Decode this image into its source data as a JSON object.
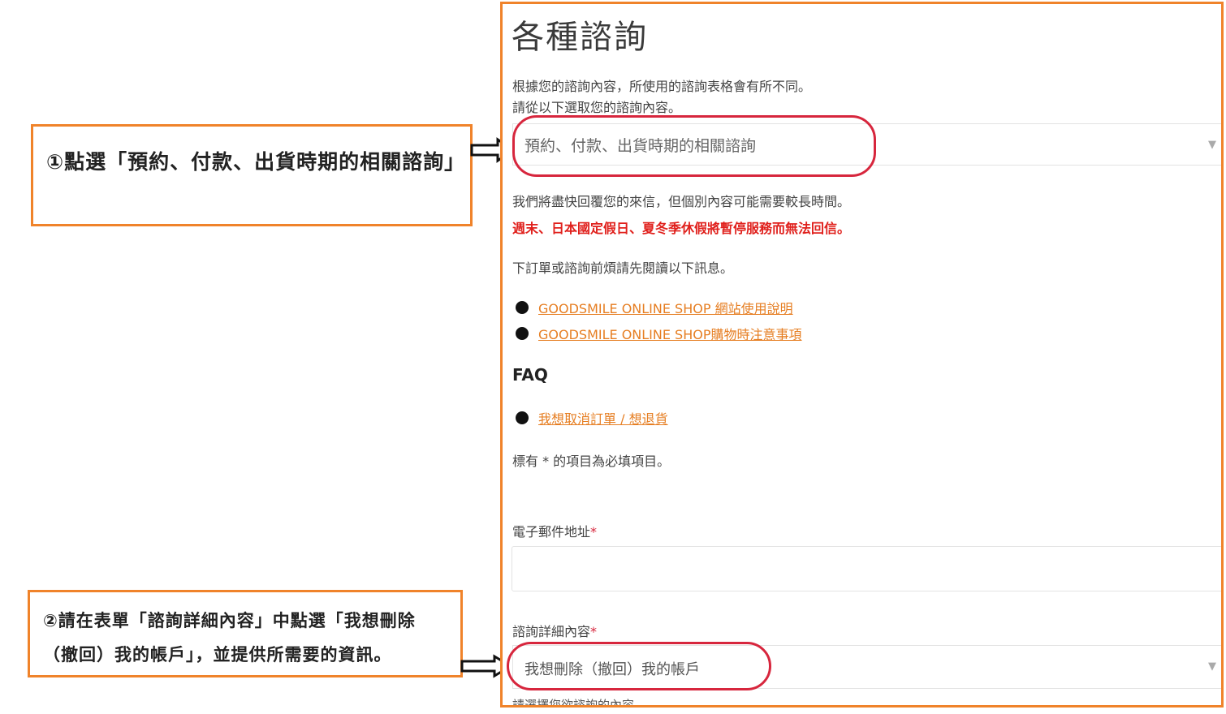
{
  "callouts": {
    "step1": "①點選「預約、付款、出貨時期的相關諮詢」",
    "step2": "②請在表單「諮詢詳細內容」中點選「我想刪除（撤回）我的帳戶」，並提供所需要的資訊。"
  },
  "form": {
    "title": "各種諮詢",
    "intro_line1": "根據您的諮詢內容，所使用的諮詢表格會有所不同。",
    "intro_line2": "請從以下選取您的諮詢內容。",
    "category_select_value": "預約、付款、出貨時期的相關諮詢",
    "reply_note": "我們將盡快回覆您的來信，但個別內容可能需要較長時間。",
    "holiday_note": "週末、日本國定假日、夏冬季休假將暫停服務而無法回信。",
    "read_note": "下訂單或諮詢前煩請先閱讀以下訊息。",
    "links": [
      "GOODSMILE ONLINE SHOP 網站使用說明",
      "GOODSMILE ONLINE SHOP購物時注意事項"
    ],
    "faq_heading": "FAQ",
    "faq_link": "我想取消訂單 / 想退貨",
    "required_note": "標有 * 的項目為必填項目。",
    "email_label": "電子郵件地址",
    "required_mark": "*",
    "detail_label": "諮詢詳細內容",
    "detail_select_value": "我想刪除（撤回）我的帳戶",
    "detail_hint": "請選擇您欲諮詢的內容。"
  },
  "colors": {
    "callout_border": "#f0832a",
    "highlight_ring": "#d7263d",
    "link": "#e67e22",
    "warning_text": "#e0201c"
  },
  "icons": {
    "arrow": "hollow-right-arrow",
    "caret": "chevron-down-icon",
    "bullet": "bullet-dot-icon"
  }
}
